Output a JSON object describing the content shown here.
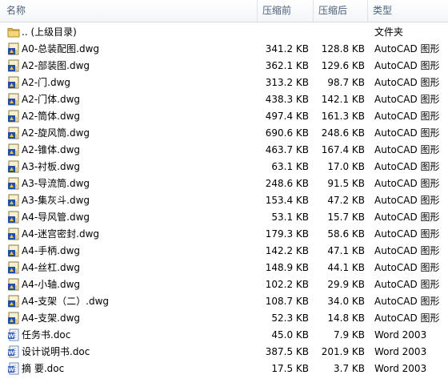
{
  "header": {
    "name": "名称",
    "size": "压缩前",
    "compressed": "压缩后",
    "type": "类型"
  },
  "rows": [
    {
      "name": ".. (上级目录)",
      "size": "",
      "compressed": "",
      "type": "文件夹",
      "icon": "folder-icon"
    },
    {
      "name": "A0-总装配图.dwg",
      "size": "341.2 KB",
      "compressed": "128.8 KB",
      "type": "AutoCAD 图形",
      "icon": "dwg-file-icon"
    },
    {
      "name": "A2-部装图.dwg",
      "size": "362.1 KB",
      "compressed": "129.6 KB",
      "type": "AutoCAD 图形",
      "icon": "dwg-file-icon"
    },
    {
      "name": "A2-门.dwg",
      "size": "313.2 KB",
      "compressed": "98.7 KB",
      "type": "AutoCAD 图形",
      "icon": "dwg-file-icon"
    },
    {
      "name": "A2-门体.dwg",
      "size": "438.3 KB",
      "compressed": "142.1 KB",
      "type": "AutoCAD 图形",
      "icon": "dwg-file-icon"
    },
    {
      "name": "A2-筒体.dwg",
      "size": "497.4 KB",
      "compressed": "161.3 KB",
      "type": "AutoCAD 图形",
      "icon": "dwg-file-icon"
    },
    {
      "name": "A2-旋风筒.dwg",
      "size": "690.6 KB",
      "compressed": "248.6 KB",
      "type": "AutoCAD 图形",
      "icon": "dwg-file-icon"
    },
    {
      "name": "A2-锥体.dwg",
      "size": "463.7 KB",
      "compressed": "167.4 KB",
      "type": "AutoCAD 图形",
      "icon": "dwg-file-icon"
    },
    {
      "name": "A3-衬板.dwg",
      "size": "63.1 KB",
      "compressed": "17.0 KB",
      "type": "AutoCAD 图形",
      "icon": "dwg-file-icon"
    },
    {
      "name": "A3-导流筒.dwg",
      "size": "248.6 KB",
      "compressed": "91.5 KB",
      "type": "AutoCAD 图形",
      "icon": "dwg-file-icon"
    },
    {
      "name": "A3-集灰斗.dwg",
      "size": "153.4 KB",
      "compressed": "47.2 KB",
      "type": "AutoCAD 图形",
      "icon": "dwg-file-icon"
    },
    {
      "name": "A4-导风管.dwg",
      "size": "53.1 KB",
      "compressed": "15.7 KB",
      "type": "AutoCAD 图形",
      "icon": "dwg-file-icon"
    },
    {
      "name": "A4-迷宫密封.dwg",
      "size": "179.3 KB",
      "compressed": "58.6 KB",
      "type": "AutoCAD 图形",
      "icon": "dwg-file-icon"
    },
    {
      "name": "A4-手柄.dwg",
      "size": "142.2 KB",
      "compressed": "47.1 KB",
      "type": "AutoCAD 图形",
      "icon": "dwg-file-icon"
    },
    {
      "name": "A4-丝杠.dwg",
      "size": "148.9 KB",
      "compressed": "44.1 KB",
      "type": "AutoCAD 图形",
      "icon": "dwg-file-icon"
    },
    {
      "name": "A4-小轴.dwg",
      "size": "102.2 KB",
      "compressed": "29.9 KB",
      "type": "AutoCAD 图形",
      "icon": "dwg-file-icon"
    },
    {
      "name": "A4-支架（二）.dwg",
      "size": "108.7 KB",
      "compressed": "34.0 KB",
      "type": "AutoCAD 图形",
      "icon": "dwg-file-icon"
    },
    {
      "name": "A4-支架.dwg",
      "size": "52.3 KB",
      "compressed": "14.8 KB",
      "type": "AutoCAD 图形",
      "icon": "dwg-file-icon"
    },
    {
      "name": "任务书.doc",
      "size": "45.0 KB",
      "compressed": "7.9 KB",
      "type": "Word 2003",
      "icon": "word-doc-icon"
    },
    {
      "name": "设计说明书.doc",
      "size": "387.5 KB",
      "compressed": "201.9 KB",
      "type": "Word 2003",
      "icon": "word-doc-icon"
    },
    {
      "name": "摘 要.doc",
      "size": "17.5 KB",
      "compressed": "3.7 KB",
      "type": "Word 2003",
      "icon": "word-doc-icon"
    }
  ]
}
